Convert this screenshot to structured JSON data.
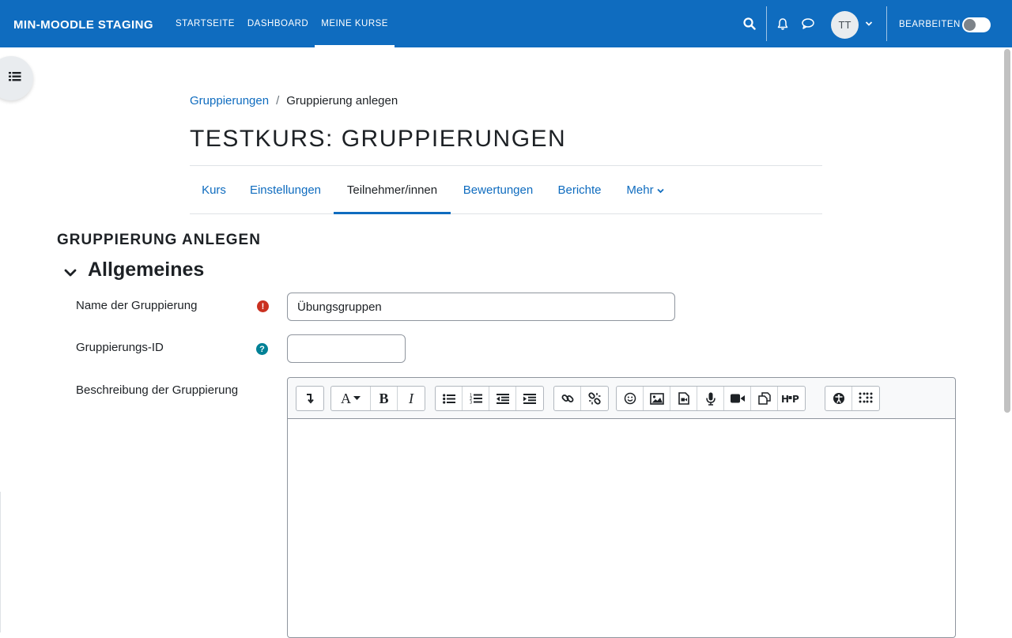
{
  "navbar": {
    "brand": "MIN-MOODLE STAGING",
    "links": [
      {
        "label": "STARTSEITE",
        "active": false
      },
      {
        "label": "DASHBOARD",
        "active": false
      },
      {
        "label": "MEINE KURSE",
        "active": true
      }
    ],
    "icons": [
      "search-icon",
      "bell-icon",
      "chat-icon"
    ],
    "avatar_initials": "TT",
    "edit_mode_label": "BEARBEITEN",
    "edit_mode_on": false
  },
  "breadcrumb": {
    "items": [
      {
        "label": "Gruppierungen",
        "link": true
      },
      {
        "label": "Gruppierung anlegen",
        "link": false
      }
    ],
    "separator": "/"
  },
  "course_title": "TESTKURS: GRUPPIERUNGEN",
  "secondary_nav": {
    "tabs": [
      {
        "label": "Kurs",
        "active": false
      },
      {
        "label": "Einstellungen",
        "active": false
      },
      {
        "label": "Teilnehmer/innen",
        "active": true
      },
      {
        "label": "Bewertungen",
        "active": false
      },
      {
        "label": "Berichte",
        "active": false
      },
      {
        "label": "Mehr",
        "active": false,
        "dropdown": true
      }
    ]
  },
  "page_heading": "GRUPPIERUNG ANLEGEN",
  "form": {
    "section_title": "Allgemeines",
    "fields": {
      "name": {
        "label": "Name der Gruppierung",
        "value": "Übungsgruppen",
        "icon": "required-icon"
      },
      "id": {
        "label": "Gruppierungs-ID",
        "value": "",
        "icon": "help-icon"
      },
      "description": {
        "label": "Beschreibung der Gruppierung",
        "value": ""
      }
    },
    "editor_toolbar_icons": [
      [
        "collapse-icon"
      ],
      [
        "font-style-icon",
        "bold-icon",
        "italic-icon"
      ],
      [
        "unordered-list-icon",
        "ordered-list-icon",
        "outdent-icon",
        "indent-icon"
      ],
      [
        "link-icon",
        "unlink-icon"
      ],
      [
        "emoji-icon",
        "image-icon",
        "media-icon",
        "record-audio-icon",
        "record-video-icon",
        "manage-files-icon",
        "h5p-icon"
      ],
      [
        "accessibility-checker-icon",
        "screenreader-helper-icon"
      ]
    ]
  },
  "colors": {
    "primary": "#0f6cbf",
    "required": "#ca3120",
    "help": "#008196"
  }
}
